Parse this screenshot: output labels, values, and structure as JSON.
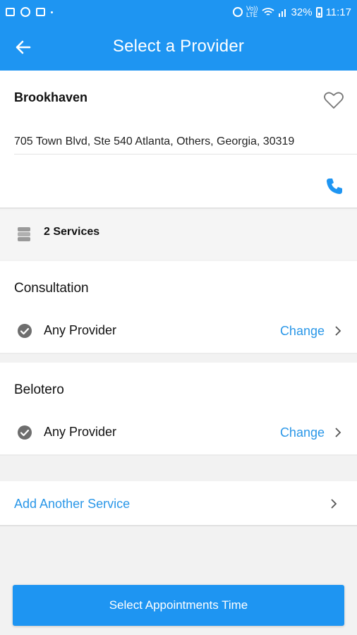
{
  "status_bar": {
    "battery": "32%",
    "time": "11:17",
    "volte": "Vo))",
    "lte": "LTE"
  },
  "header": {
    "title": "Select a Provider",
    "back_icon": "arrow-left-icon"
  },
  "location": {
    "name": "Brookhaven",
    "address": "705 Town Blvd, Ste 540 Atlanta, Others, Georgia, 30319",
    "favorite_icon": "heart-outline-icon",
    "phone_icon": "phone-icon"
  },
  "services_summary": {
    "count_label": "2 Services",
    "icon": "stack-icon"
  },
  "services": [
    {
      "name": "Consultation",
      "provider": "Any Provider",
      "change_label": "Change"
    },
    {
      "name": "Belotero",
      "provider": "Any Provider",
      "change_label": "Change"
    }
  ],
  "add_service": {
    "label": "Add Another Service"
  },
  "cta": {
    "label": "Select Appointments Time"
  },
  "colors": {
    "accent": "#1e95f2",
    "link": "#2a97e8"
  }
}
